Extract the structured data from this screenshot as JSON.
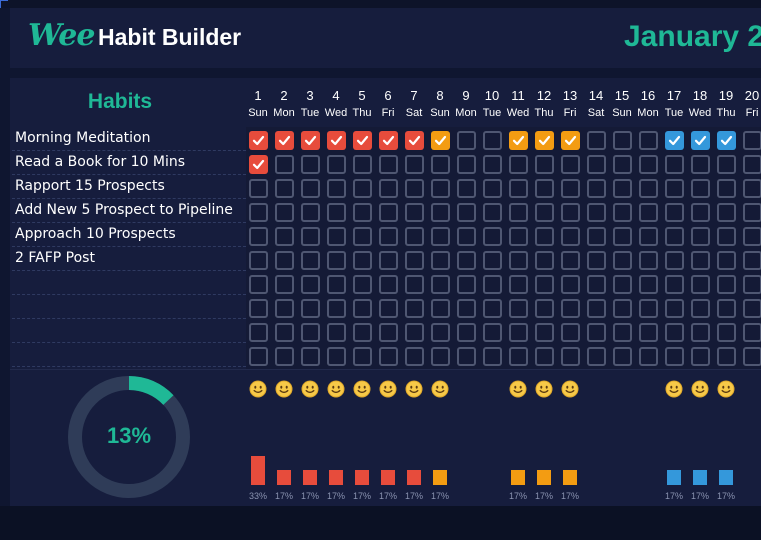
{
  "header": {
    "logo_text": "Wee",
    "title": "Habit Builder",
    "month": "January 2"
  },
  "habits_panel": {
    "title": "Habits"
  },
  "colors": {
    "accent": "#1fb896",
    "week1": "#e74c3c",
    "week2": "#f39c12",
    "week3": "#3498db",
    "empty_border": "#4f5772"
  },
  "days": [
    {
      "num": "1",
      "wd": "Sun"
    },
    {
      "num": "2",
      "wd": "Mon"
    },
    {
      "num": "3",
      "wd": "Tue"
    },
    {
      "num": "4",
      "wd": "Wed"
    },
    {
      "num": "5",
      "wd": "Thu"
    },
    {
      "num": "6",
      "wd": "Fri"
    },
    {
      "num": "7",
      "wd": "Sat"
    },
    {
      "num": "8",
      "wd": "Sun"
    },
    {
      "num": "9",
      "wd": "Mon"
    },
    {
      "num": "10",
      "wd": "Tue"
    },
    {
      "num": "11",
      "wd": "Wed"
    },
    {
      "num": "12",
      "wd": "Thu"
    },
    {
      "num": "13",
      "wd": "Fri"
    },
    {
      "num": "14",
      "wd": "Sat"
    },
    {
      "num": "15",
      "wd": "Sun"
    },
    {
      "num": "16",
      "wd": "Mon"
    },
    {
      "num": "17",
      "wd": "Tue"
    },
    {
      "num": "18",
      "wd": "Wed"
    },
    {
      "num": "19",
      "wd": "Thu"
    },
    {
      "num": "20",
      "wd": "Fri"
    }
  ],
  "habits": [
    {
      "label": "Morning Meditation",
      "done": [
        1,
        2,
        3,
        4,
        5,
        6,
        7,
        8,
        11,
        12,
        13,
        17,
        18,
        19
      ]
    },
    {
      "label": "Read a Book for 10 Mins",
      "done": [
        1
      ]
    },
    {
      "label": "Rapport 15 Prospects",
      "done": []
    },
    {
      "label": "Add New 5 Prospect to Pipeline",
      "done": []
    },
    {
      "label": "Approach 10 Prospects",
      "done": []
    },
    {
      "label": "2 FAFP Post",
      "done": []
    },
    {
      "label": "",
      "done": []
    },
    {
      "label": "",
      "done": []
    },
    {
      "label": "",
      "done": []
    },
    {
      "label": "",
      "done": []
    }
  ],
  "progress": {
    "label": "13%",
    "value": 0.13
  },
  "daily_completion": [
    {
      "day": "1",
      "pct": 0.33,
      "label": "33%",
      "smiley": "smiley-icon"
    },
    {
      "day": "2",
      "pct": 0.17,
      "label": "17%",
      "smiley": "smiley-icon"
    },
    {
      "day": "3",
      "pct": 0.17,
      "label": "17%",
      "smiley": "smiley-icon"
    },
    {
      "day": "4",
      "pct": 0.17,
      "label": "17%",
      "smiley": "smiley-icon"
    },
    {
      "day": "5",
      "pct": 0.17,
      "label": "17%",
      "smiley": "smiley-icon"
    },
    {
      "day": "6",
      "pct": 0.17,
      "label": "17%",
      "smiley": "smiley-icon"
    },
    {
      "day": "7",
      "pct": 0.17,
      "label": "17%",
      "smiley": "smiley-icon"
    },
    {
      "day": "8",
      "pct": 0.17,
      "label": "17%",
      "smiley": "smiley-icon"
    },
    {
      "day": "11",
      "pct": 0.17,
      "label": "17%",
      "smiley": "smiley-icon"
    },
    {
      "day": "12",
      "pct": 0.17,
      "label": "17%",
      "smiley": "smiley-icon"
    },
    {
      "day": "13",
      "pct": 0.17,
      "label": "17%",
      "smiley": "smiley-icon"
    },
    {
      "day": "17",
      "pct": 0.17,
      "label": "17%",
      "smiley": "smiley-icon"
    },
    {
      "day": "18",
      "pct": 0.17,
      "label": "17%",
      "smiley": "smiley-icon"
    },
    {
      "day": "19",
      "pct": 0.17,
      "label": "17%",
      "smiley": "smiley-icon"
    }
  ]
}
